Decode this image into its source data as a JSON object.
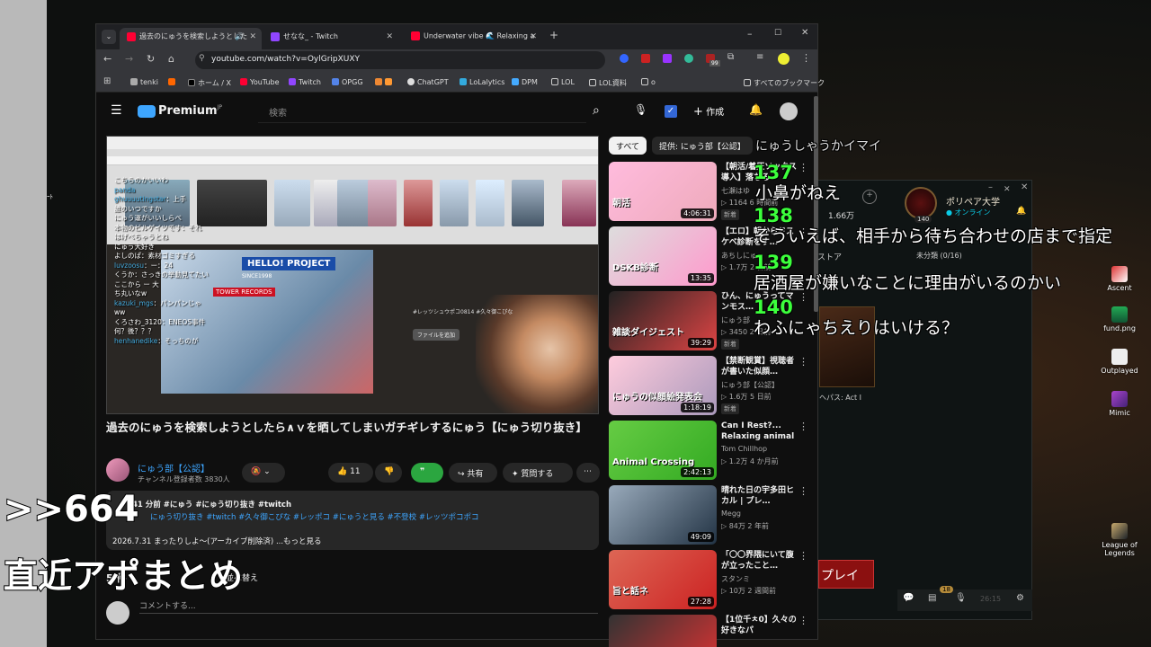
{
  "desktop": {
    "left_label": "ｰﾄ",
    "icons": [
      {
        "label": "Ascent",
        "icon": "valorant-map-icon"
      },
      {
        "label": "fund.png",
        "icon": "image-file-icon"
      },
      {
        "label": "Outplayed",
        "icon": "outplayed-app-icon"
      },
      {
        "label": "Mimic",
        "icon": "mimic-icon"
      },
      {
        "label": "League of Legends",
        "icon": "league-of-legends-icon"
      }
    ]
  },
  "lol_client": {
    "player_name": "ポリペア大学",
    "status": "オンライン",
    "level": "140",
    "currency": "1.66万",
    "store_label": "ストア",
    "unsorted": "未分類 (0/16)",
    "event_label": "ヘパス: Act I",
    "play_button": "プレイ",
    "bottom_badge": "18",
    "bottom_time": "26:15"
  },
  "browser": {
    "tabs": [
      {
        "title": "過去のにゅうを検索しようとした",
        "active": true
      },
      {
        "title": "せなな_ - Twitch",
        "active": false
      },
      {
        "title": "Underwater vibe 🌊 Relaxing a",
        "active": false
      }
    ],
    "url": "youtube.com/watch?v=OylGripXUXY",
    "bookmarks": [
      "tenki",
      "ホーム / X",
      "YouTube",
      "Twitch",
      "OPGG",
      "ChatGPT",
      "LoLalytics",
      "DPM",
      "LOL",
      "LOL資料",
      "o"
    ],
    "all_bookmarks": "すべてのブックマーク",
    "ext_badge": "99"
  },
  "youtube": {
    "logo": "Premium",
    "logo_sup": "JP",
    "search_placeholder": "検索",
    "create_label": "作成",
    "video_title": "過去のにゅうを検索しようとしたら∧ｖを晒してしまいガチギレするにゅう【にゅう切り抜き】",
    "channel_name": "にゅう部【公認】",
    "subscribers": "チャンネル登録者数 3830人",
    "likes": "11",
    "share_label": "共有",
    "ask_label": "質問する",
    "desc_line1": "41 分前 #にゅう #にゅう切り抜き #twitch",
    "desc_tags": "にゅう切り抜き #twitch #久々御こぴな #レッポコ #にゅうと見る #不登校 #レッツポコポコ",
    "desc_line3": "2026.7.31 まったりしよ〜(アーカイブ削除済) ...もっと見る",
    "comments_count": "5 件",
    "sort_label": "並べ替え",
    "comment_placeholder": "コメントする...",
    "chips": [
      "すべて",
      "提供: にゅう部【公認】"
    ],
    "video_overlay": {
      "ticket_text": "TOWER RECORDS",
      "sign_text": "HELLO! PROJECT",
      "since": "SINCE1998",
      "file_btn": "ファイルを追加",
      "hash_text": "#レッツシュウポコ0814 #久々御こぴな"
    },
    "stream_chat": [
      {
        "user": "",
        "text": "こちらのかいいわ"
      },
      {
        "user": "panda",
        "text": ""
      },
      {
        "user": "ghuuuutingstar",
        "text": "上手"
      },
      {
        "user": "",
        "text": "誰のいつですか"
      },
      {
        "user": "",
        "text": "にゅう運がいいしらべ"
      },
      {
        "user": "",
        "text": "本物のビルゲイツです：それ"
      },
      {
        "user": "",
        "text": "はげべちゃうとね"
      },
      {
        "user": "",
        "text": "にゅう大好き"
      },
      {
        "user": "",
        "text": "よしのぱ：素材ゴミすぎる"
      },
      {
        "user": "luvzoosu",
        "text": "ー：24"
      },
      {
        "user": "",
        "text": "くうか：さっきの挙動見てたい"
      },
      {
        "user": "",
        "text": "ここから ー 大"
      },
      {
        "user": "",
        "text": "ち丸いなw"
      },
      {
        "user": "kazuki_mgs",
        "text": "パンパンじゃ"
      },
      {
        "user": "",
        "text": "ww"
      },
      {
        "user": "",
        "text": "くろさわ_3120：ENEOS事件"
      },
      {
        "user": "",
        "text": "何？後？？？"
      },
      {
        "user": "henhanedike",
        "text": "そっちのが"
      }
    ],
    "recommendations": [
      {
        "title": "【朝活/着圧ソックス導入】落ちる",
        "channel": "七瀬はゆ",
        "meta": "▷ 1164  6 時間前",
        "badge": "新着",
        "duration": "4:06:31"
      },
      {
        "title": "【エロ】朝からドスケベ診断をす…",
        "channel": "あちしにゅ",
        "meta": "▷ 1.7万  2 日前",
        "badge": "",
        "duration": "13:35"
      },
      {
        "title": "ひん、にゅうってマンモス…",
        "channel": "にゅう部",
        "meta": "▷ 3450  2 日前",
        "badge": "新着",
        "duration": "39:29"
      },
      {
        "title": "【禁断観賞】視聴者が書いた似顔…",
        "channel": "にゅう部【公認】",
        "meta": "▷ 1.6万  5 日前",
        "badge": "新着",
        "duration": "1:18:19"
      },
      {
        "title": "Can I Rest?... Relaxing animal ...",
        "channel": "Tom Chillhop",
        "meta": "▷ 1.2万  4 か月前",
        "badge": "",
        "duration": "2:42:13"
      },
      {
        "title": "晴れた日の宇多田ヒカル | プレ…",
        "channel": "Megg",
        "meta": "▷ 84万  2 年前",
        "badge": "",
        "duration": "49:09"
      },
      {
        "title": "「〇〇界隈にいて腹が立ったこと…",
        "channel": "スタンミ",
        "meta": "▷ 10万  2 週間前",
        "badge": "",
        "duration": "27:28"
      },
      {
        "title": "【1位千ㅊ0】久々の好きなパ",
        "channel": "",
        "meta": "",
        "badge": "",
        "duration": ""
      }
    ],
    "rec_thumb_texts": [
      "朝活",
      "DSKB診断",
      "雑談ダイジェスト",
      "にゅうの似顔絵発表会",
      "Animal Crossing",
      "",
      "旨と話ネ"
    ]
  },
  "overlay": {
    "anchor": ">>664",
    "caption": "直近アポまとめ",
    "nico_comments": [
      {
        "num": "137",
        "text": "小鼻がねえ"
      },
      {
        "num": "138",
        "text": "そういえば、相手から待ち合わせの店まで指定"
      },
      {
        "num": "139",
        "text": "居酒屋が嫌いなことに理由がいるのかい"
      },
      {
        "num": "140",
        "text": "わふにゃちえりはいける？"
      }
    ],
    "partial_top": "にゅうしゃうかイマイ"
  },
  "colors": {
    "yt_red": "#ff0033",
    "nico_number": "#3cff3c",
    "youtube_bg": "#0f0f0f",
    "lol_red": "#8b1010"
  }
}
